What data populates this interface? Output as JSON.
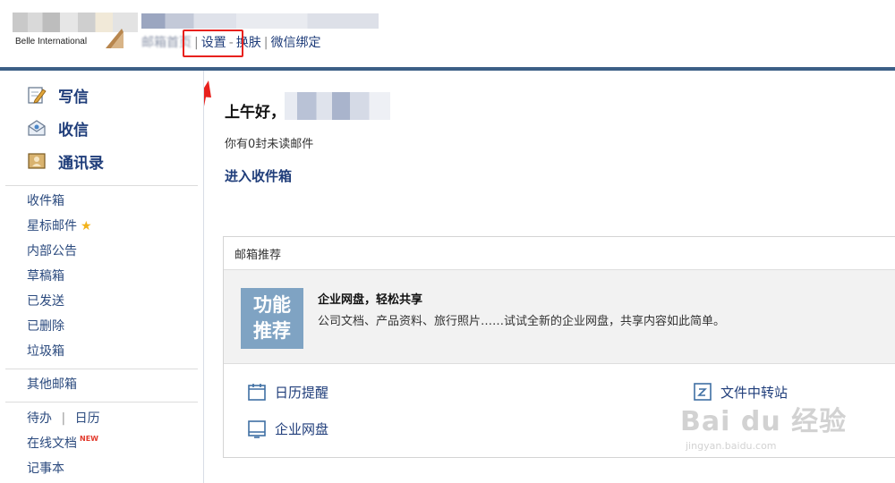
{
  "header": {
    "logo_text": "Belle International",
    "links": [
      {
        "label": "邮箱首页",
        "obscured": true
      },
      {
        "label": "设置"
      },
      {
        "label": "换肤"
      },
      {
        "label": "微信绑定"
      }
    ]
  },
  "sidebar": {
    "actions": [
      {
        "label": "写信",
        "icon": "compose-icon"
      },
      {
        "label": "收信",
        "icon": "inbox-envelope-icon"
      },
      {
        "label": "通讯录",
        "icon": "contacts-icon"
      }
    ],
    "folders": [
      {
        "label": "收件箱"
      },
      {
        "label": "星标邮件"
      },
      {
        "label": "内部公告"
      },
      {
        "label": "草稿箱"
      },
      {
        "label": "已发送"
      },
      {
        "label": "已删除"
      },
      {
        "label": "垃圾箱"
      }
    ],
    "other_mailbox": "其他邮箱",
    "todo": "待办",
    "separator": "|",
    "calendar": "日历",
    "online_docs": "在线文档",
    "new_tag": "NEW",
    "notebook": "记事本"
  },
  "main": {
    "greeting": "上午好，",
    "unread_text": "你有0封未读邮件",
    "enter_inbox": "进入收件箱",
    "recommend": {
      "title": "邮箱推荐",
      "badge_line1": "功能",
      "badge_line2": "推荐",
      "feature_title": "企业网盘，轻松共享",
      "feature_desc": "公司文档、产品资料、旅行照片……试试全新的企业网盘，共享内容如此简单。",
      "tools": [
        {
          "label": "日历提醒",
          "icon": "calendar-icon"
        },
        {
          "label": "文件中转站",
          "icon": "file-transfer-icon"
        },
        {
          "label": "企业网盘",
          "icon": "cloud-disk-icon"
        }
      ]
    }
  },
  "watermark": {
    "main": "Bai du 经验",
    "sub": "jingyan.baidu.com"
  },
  "colors": {
    "link": "#1f3d7a",
    "header_bar": "#3c5f86",
    "highlight": "#e8211d",
    "badge": "#7fa3c3"
  }
}
